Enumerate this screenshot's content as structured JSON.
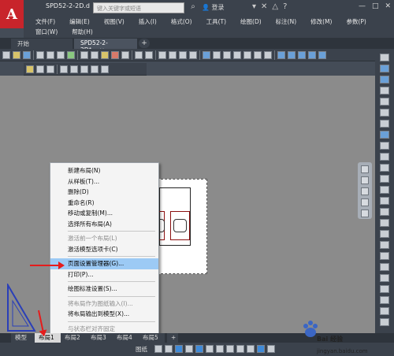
{
  "app": {
    "logo_letter": "A",
    "doc_title": "SPD52-2-2D.d",
    "search_placeholder": "键入关键字或短语",
    "login_label": "登录",
    "window_controls": [
      "—",
      "□",
      "✕"
    ]
  },
  "menubar": {
    "row1": [
      "文件(F)",
      "编辑(E)",
      "视图(V)",
      "插入(I)",
      "格式(O)",
      "工具(T)",
      "绘图(D)",
      "标注(N)",
      "修改(M)",
      "参数(P)"
    ],
    "row2": [
      "窗口(W)",
      "帮助(H)"
    ]
  },
  "file_tabs": {
    "start": "开始",
    "doc": "SPD52-2-2D*",
    "close": "×",
    "add": "+"
  },
  "context_menu": {
    "items": [
      {
        "label": "新建布局(N)",
        "enabled": true
      },
      {
        "label": "从样板(T)...",
        "enabled": true
      },
      {
        "label": "删除(D)",
        "enabled": true
      },
      {
        "label": "重命名(R)",
        "enabled": true
      },
      {
        "label": "移动或复制(M)...",
        "enabled": true
      },
      {
        "label": "选择所有布局(A)",
        "enabled": true
      },
      {
        "sep": true
      },
      {
        "label": "激活前一个布局(L)",
        "enabled": false
      },
      {
        "label": "激活模型选项卡(C)",
        "enabled": true
      },
      {
        "sep": true
      },
      {
        "label": "页面设置管理器(G)...",
        "enabled": true,
        "highlighted": true
      },
      {
        "label": "打印(P)...",
        "enabled": true
      },
      {
        "sep": true
      },
      {
        "label": "绘图标准设置(S)...",
        "enabled": true
      },
      {
        "sep": true
      },
      {
        "label": "将布局作为图纸输入(I)...",
        "enabled": false
      },
      {
        "label": "将布局输出到模型(X)...",
        "enabled": true
      },
      {
        "sep": true
      },
      {
        "label": "与状态栏对齐固定",
        "enabled": false
      }
    ]
  },
  "layout_tabs": [
    "模型",
    "布局1",
    "布局2",
    "布局3",
    "布局4",
    "布局5",
    "+"
  ],
  "status": {
    "paper_label": "图纸"
  },
  "watermark": {
    "brand": "Bai 经验",
    "url": "jingyan.baidu.com"
  },
  "colors": {
    "accent_red": "#c8242b",
    "highlight": "#9ccaf5",
    "arrow": "#e51c1c"
  }
}
